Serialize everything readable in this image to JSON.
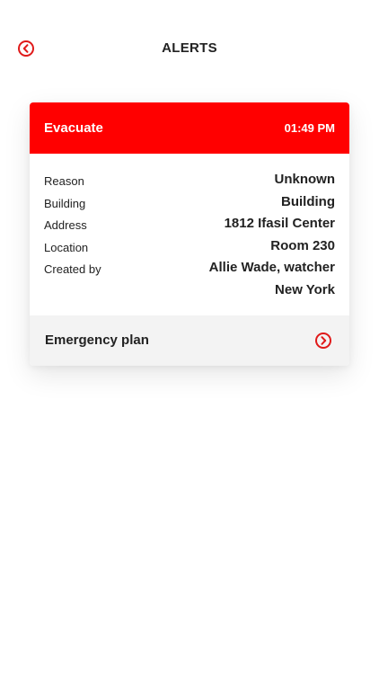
{
  "header": {
    "title": "ALERTS",
    "back_icon": "chevron-left-circle-icon"
  },
  "alert": {
    "type": "Evacuate",
    "time": "01:49 PM",
    "header_color": "#ff0000",
    "details": [
      {
        "label": "Reason",
        "value": "Unknown"
      },
      {
        "label": "Building",
        "value": "Building"
      },
      {
        "label": "Address",
        "value": "1812 Ifasil Center"
      },
      {
        "label": "Location",
        "value": "Room 230"
      },
      {
        "label": "Created by",
        "value": "Allie Wade, watcher"
      },
      {
        "label": "",
        "value": "New York"
      }
    ],
    "footer": {
      "label": "Emergency plan",
      "icon": "chevron-right-circle-icon"
    }
  },
  "colors": {
    "accent": "#ff0000",
    "icon_red": "#e01a1a",
    "text": "#222222",
    "footer_bg": "#f3f3f3"
  }
}
